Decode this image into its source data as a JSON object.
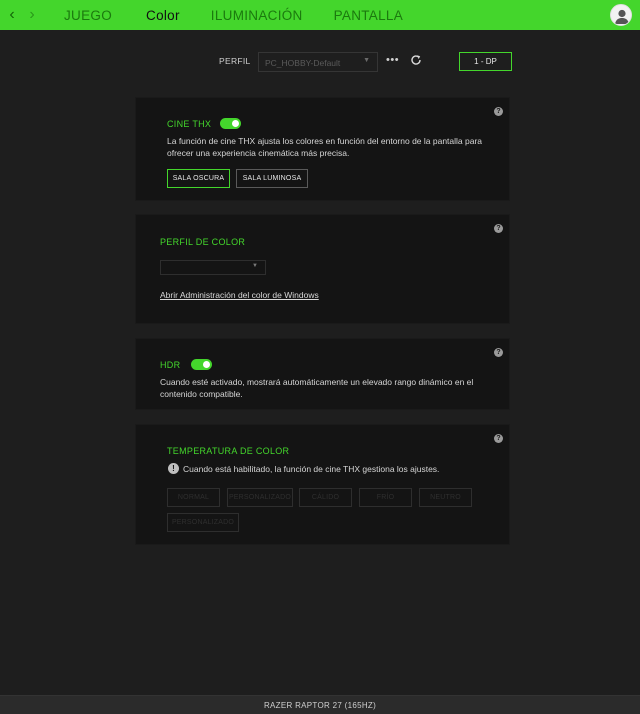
{
  "nav": {
    "tabs": [
      {
        "label": "JUEGO"
      },
      {
        "label": "Color"
      },
      {
        "label": "ILUMINACIÓN"
      },
      {
        "label": "PANTALLA"
      }
    ]
  },
  "toolbar": {
    "perfil_label": "PERFIL",
    "profile_value": "PC_HOBBY-Default",
    "more_label": "•••",
    "device_label": "1 - DP"
  },
  "cine": {
    "title": "CINE THX",
    "enabled": true,
    "description": "La función de cine THX ajusta los colores en función del entorno de la pantalla para ofrecer una experiencia cinemática más precisa.",
    "buttons": [
      "SALA OSCURA",
      "SALA LUMINOSA"
    ],
    "selected": "SALA OSCURA"
  },
  "color_profile": {
    "title": "PERFIL DE COLOR",
    "link": "Abrir Administración del color de Windows"
  },
  "hdr": {
    "title": "HDR",
    "enabled": true,
    "description": "Cuando esté activado, mostrará automáticamente un elevado rango dinámico en el contenido compatible."
  },
  "temperature": {
    "title": "TEMPERATURA DE COLOR",
    "notice": "Cuando está habilitado, la función de cine THX gestiona los ajustes.",
    "presets": [
      "NORMAL",
      "PERSONALIZADO",
      "CÁLIDO",
      "FRÍO",
      "NEUTRO",
      "PERSONALIZADO"
    ]
  },
  "footer": {
    "device_name": "RAZER RAPTOR 27 (165HZ)"
  },
  "colors": {
    "accent": "#44d62c",
    "panel": "#141414",
    "background": "#1e1e1e"
  }
}
